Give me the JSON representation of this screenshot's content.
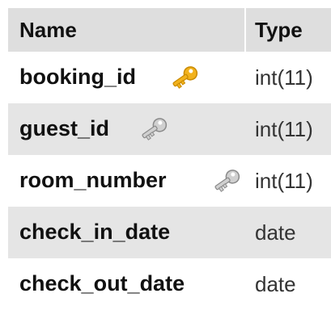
{
  "columns": {
    "name": "Name",
    "type": "Type"
  },
  "rows": [
    {
      "field": "booking_id",
      "type": "int(11)",
      "key": "primary-key-icon",
      "key_color": "#f2b21c"
    },
    {
      "field": "guest_id",
      "type": "int(11)",
      "key": "index-key-icon",
      "key_color": "#a8a8a8"
    },
    {
      "field": "room_number",
      "type": "int(11)",
      "key": "index-key-icon",
      "key_color": "#a8a8a8"
    },
    {
      "field": "check_in_date",
      "type": "date"
    },
    {
      "field": "check_out_date",
      "type": "date"
    }
  ]
}
